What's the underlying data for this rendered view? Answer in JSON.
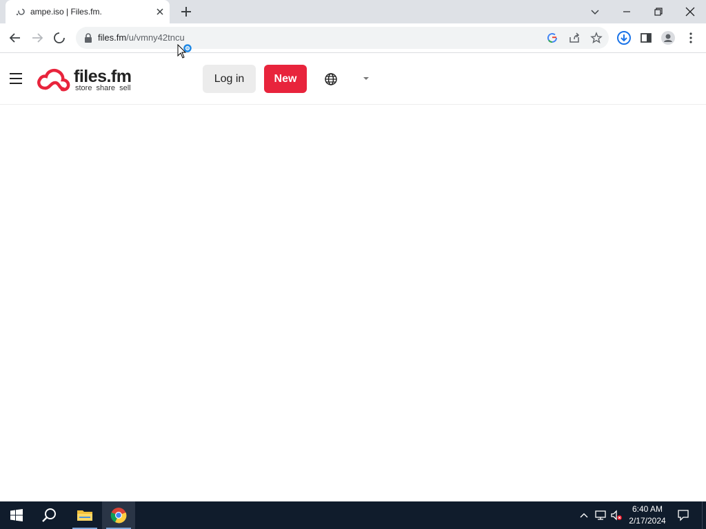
{
  "browser": {
    "tab_title": "ampe.iso | Files.fm.",
    "url_host": "files.fm",
    "url_path": "/u/vmny42tncu"
  },
  "site": {
    "logo_name": "files.fm",
    "logo_tagline": "store  share  sell",
    "login_label": "Log in",
    "new_label": "New",
    "brand_color": "#e8243c"
  },
  "taskbar": {
    "time": "6:40 AM",
    "date": "2/17/2024"
  }
}
